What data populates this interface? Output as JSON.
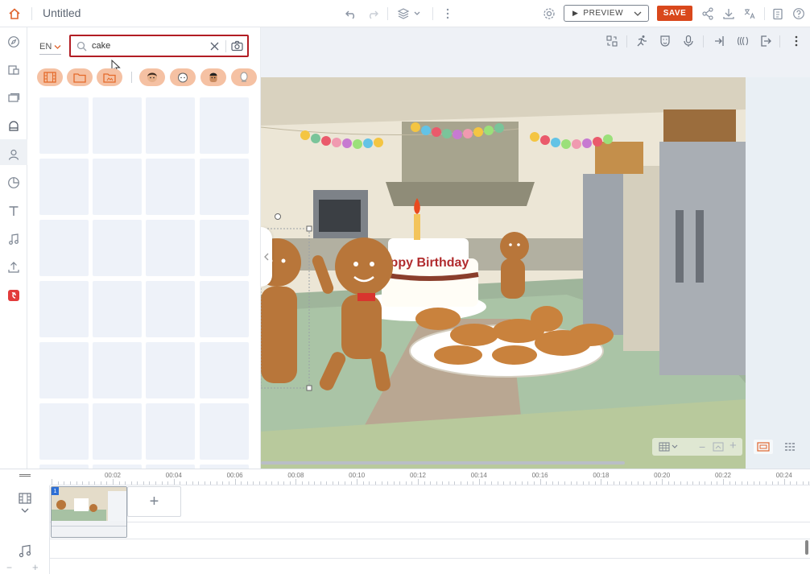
{
  "topbar": {
    "title": "Untitled",
    "preview_label": "PREVIEW",
    "save_label": "SAVE"
  },
  "panel": {
    "language": "EN",
    "search": {
      "value": "cake",
      "placeholder": ""
    }
  },
  "scene": {
    "banner_text": "appy Birthday"
  },
  "timeline": {
    "scene_number": "1",
    "ticks": [
      "00:02",
      "00:04",
      "00:06",
      "00:08",
      "00:10",
      "00:12",
      "00:14",
      "00:16",
      "00:18",
      "00:20",
      "00:22",
      "00:24"
    ]
  },
  "colors": {
    "accent": "#d9481c",
    "search_border": "#b21d24",
    "thumb_placeholder": "#eef2f9",
    "chip": "#f5c1a3"
  },
  "icons": {
    "home": "home-icon",
    "undo": "undo-icon",
    "redo": "redo-icon",
    "layers": "layers-icon",
    "settings": "gear-icon",
    "share": "share-icon",
    "download": "download-icon",
    "translate": "translate-icon",
    "notes": "clipboard-icon",
    "help": "help-icon"
  }
}
